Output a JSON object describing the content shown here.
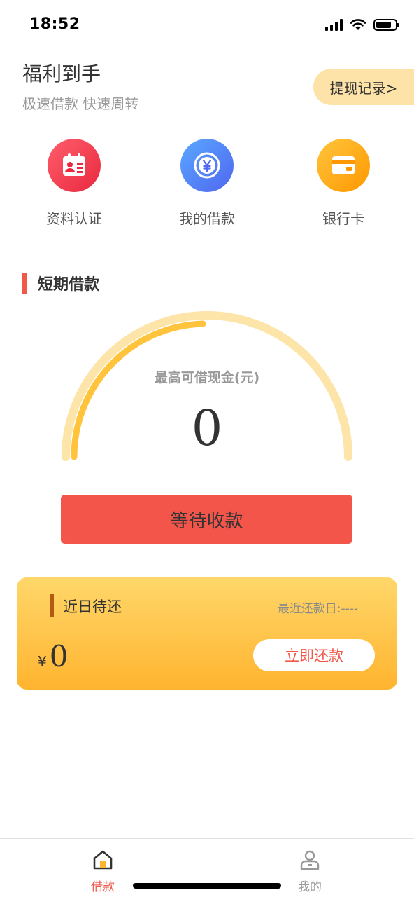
{
  "status_bar": {
    "time": "18:52"
  },
  "header": {
    "title": "福利到手",
    "subtitle": "极速借款 快速周转",
    "withdraw_record": "提现记录>"
  },
  "quick_actions": [
    {
      "label": "资料认证",
      "icon": "id-card-icon",
      "color": "#e9283e"
    },
    {
      "label": "我的借款",
      "icon": "yen-coin-icon",
      "color": "#4f66f0"
    },
    {
      "label": "银行卡",
      "icon": "bank-card-icon",
      "color": "#ff9800"
    }
  ],
  "loan_section": {
    "title": "短期借款",
    "gauge_label": "最高可借现金(元)",
    "gauge_value": "0",
    "button_label": "等待收款"
  },
  "repay_card": {
    "title": "近日待还",
    "latest_date": "最近还款日:----",
    "currency": "¥",
    "amount": "0",
    "button_label": "立即还款"
  },
  "tab_bar": {
    "items": [
      {
        "label": "借款",
        "icon": "home-icon",
        "active": true,
        "color": "#f0584a"
      },
      {
        "label": "我的",
        "icon": "user-icon",
        "active": false,
        "color": "#999999"
      }
    ]
  },
  "colors": {
    "accent": "#f4554a",
    "gauge_track": "#fde4a8",
    "gauge_fill": "#ffc43b"
  }
}
